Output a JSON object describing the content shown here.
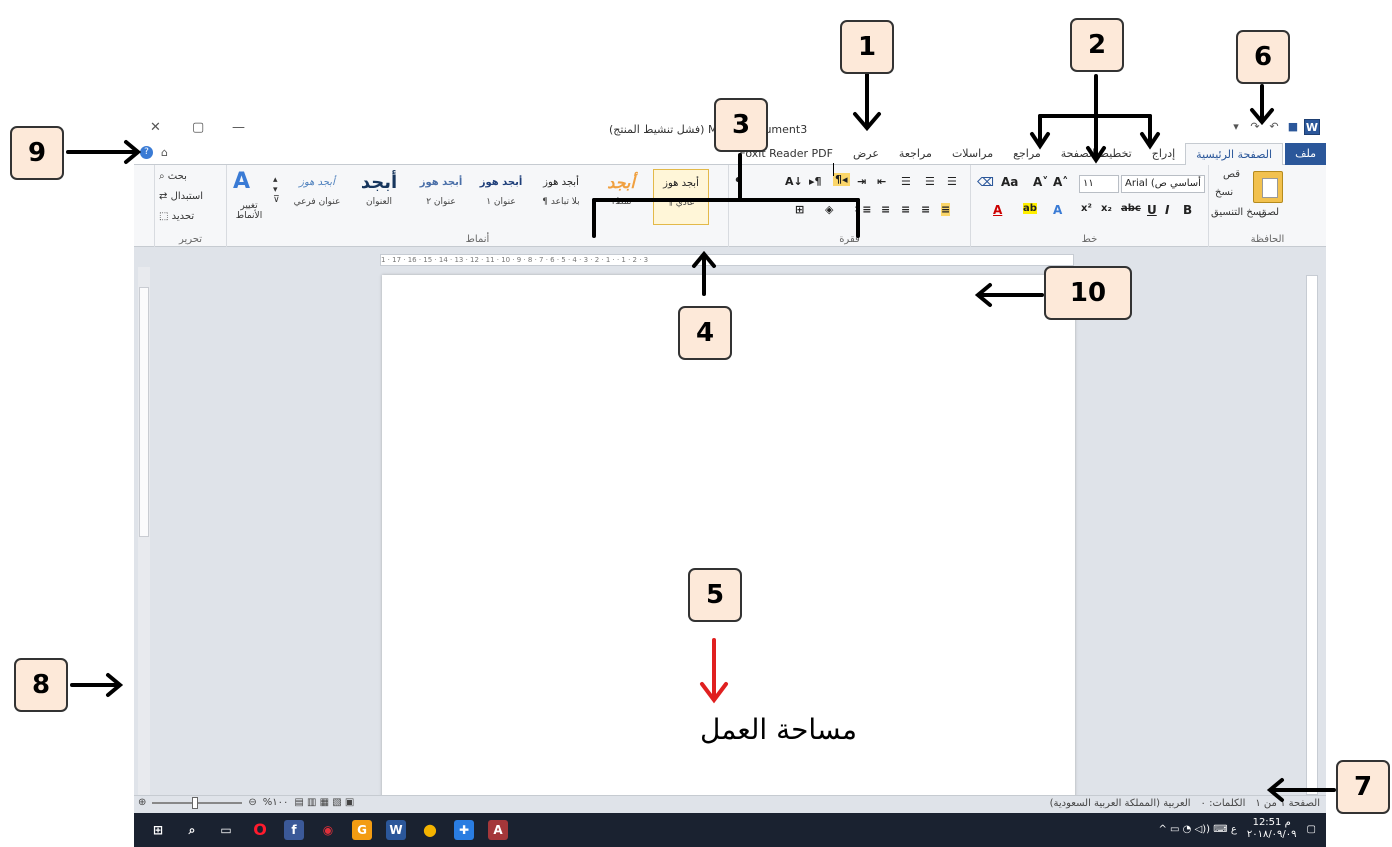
{
  "window": {
    "title": "Microsoft Word - Document3 (فشل تنشيط المنتج)",
    "title_visible": "(فشل تنشيط المنتج) M         rd - Document3"
  },
  "tabs": [
    {
      "label": "ملف",
      "type": "file"
    },
    {
      "label": "الصفحة الرئيسية",
      "type": "active"
    },
    {
      "label": "إدراج"
    },
    {
      "label": "تخطيط الصفحة"
    },
    {
      "label": "مراجع"
    },
    {
      "label": "مراسلات"
    },
    {
      "label": "مراجعة"
    },
    {
      "label": "عرض"
    },
    {
      "label": "Foxit Reader PDF"
    }
  ],
  "ribbon": {
    "clipboard": {
      "label": "الحافظة",
      "paste": "لصق",
      "cut": "قص",
      "copy": "نسخ",
      "format_painter": "نسخ التنسيق"
    },
    "font": {
      "label": "خط",
      "font_name": "Arial (أساسي ص",
      "font_size": "١١"
    },
    "paragraph": {
      "label": "فقرة"
    },
    "styles": {
      "label": "أنماط",
      "items": [
        {
          "sample": "أبجد هوز",
          "name": "¶ عادي",
          "selected": true
        },
        {
          "sample": "أبجد",
          "name": "نمط١"
        },
        {
          "sample": "أبجد هوز",
          "name": "¶ بلا تباعد"
        },
        {
          "sample": "أبجد هوز",
          "name": "عنوان ١"
        },
        {
          "sample": "أبجد هوز",
          "name": "عنوان ٢"
        },
        {
          "sample": "أبجد",
          "name": "العنوان"
        },
        {
          "sample": "أبجد هوز",
          "name": "عنوان فرعي"
        }
      ],
      "change_styles": "تغيير الأنماط"
    },
    "editing": {
      "label": "تحرير",
      "find": "بحث",
      "replace": "استبدال",
      "select": "تحديد"
    }
  },
  "status": {
    "page": "الصفحة ١ من ١",
    "words": "الكلمات: ٠",
    "language": "العربية (المملكة العربية السعودية)",
    "zoom": "%١٠٠"
  },
  "clock": {
    "time": "12:51 م",
    "date": "٢٠١٨/٠٩/٠٩"
  },
  "ruler": {
    "marks": "1 · 17 · 16 · 15 · 14 · 13 · 12 · 11 · 10 · 9 · 8 · 7 · 6 · 5 · 4 · 3 · 2 · 1 · · 1 · 2 · 3"
  },
  "annotations": {
    "n1": "1",
    "n2": "2",
    "n3": "3",
    "n4": "4",
    "n5": "5",
    "n6": "6",
    "n7": "7",
    "n8": "8",
    "n9": "9",
    "n10": "10",
    "work_area": "مساحة العمل"
  },
  "colors": {
    "accent": "#2b579a",
    "badge": "#fde9d9",
    "arrow_red": "#e02020"
  }
}
